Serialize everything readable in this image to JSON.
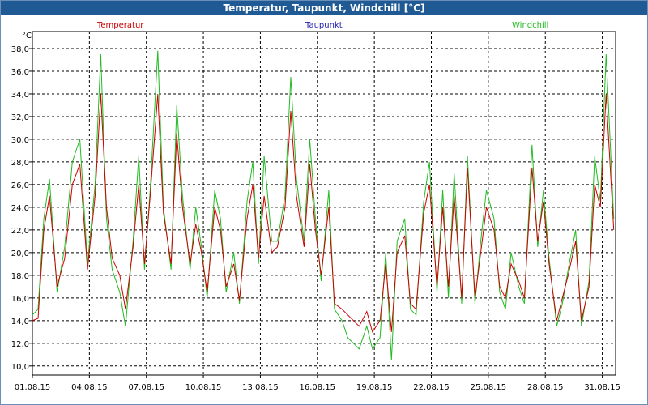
{
  "window": {
    "title": "Temperatur, Taupunkt, Windchill [°C]"
  },
  "colors": {
    "temperatur": "#cc0000",
    "taupunkt": "#2020b0",
    "windchill": "#22bb22",
    "grid": "#000000",
    "title_bg": "#1f5a94"
  },
  "chart_data": {
    "type": "line",
    "title": "Temperatur, Taupunkt, Windchill [°C]",
    "ylabel": "°C",
    "xlabel": "",
    "ylim": [
      9.2,
      39.5
    ],
    "xlim": [
      0,
      30.7
    ],
    "grid": true,
    "legend_position": "top",
    "yticks": [
      "10,0",
      "12,0",
      "14,0",
      "16,0",
      "18,0",
      "20,0",
      "22,0",
      "24,0",
      "26,0",
      "28,0",
      "30,0",
      "32,0",
      "34,0",
      "36,0",
      "38,0"
    ],
    "ytick_values": [
      10,
      12,
      14,
      16,
      18,
      20,
      22,
      24,
      26,
      28,
      30,
      32,
      34,
      36,
      38
    ],
    "xticks": [
      "01.08.15",
      "04.08.15",
      "07.08.15",
      "10.08.15",
      "13.08.15",
      "16.08.15",
      "19.08.15",
      "22.08.15",
      "25.08.15",
      "28.08.15",
      "31.08.15"
    ],
    "xtick_values": [
      0,
      3,
      6,
      9,
      12,
      15,
      18,
      21,
      24,
      27,
      30
    ],
    "series": [
      {
        "name": "Temperatur",
        "x": [
          0,
          0.3,
          0.6,
          0.9,
          1.3,
          1.7,
          2.1,
          2.5,
          2.9,
          3.3,
          3.6,
          3.9,
          4.2,
          4.6,
          4.9,
          5.3,
          5.6,
          5.9,
          6.2,
          6.6,
          6.9,
          7.3,
          7.6,
          7.9,
          8.3,
          8.6,
          8.9,
          9.2,
          9.6,
          9.9,
          10.2,
          10.6,
          10.9,
          11.3,
          11.6,
          11.9,
          12.2,
          12.6,
          12.9,
          13.3,
          13.6,
          13.9,
          14.3,
          14.6,
          14.9,
          15.2,
          15.6,
          15.9,
          16.3,
          16.6,
          16.9,
          17.2,
          17.6,
          17.9,
          18.3,
          18.6,
          18.9,
          19.2,
          19.6,
          19.9,
          20.2,
          20.6,
          20.9,
          21.3,
          21.6,
          21.9,
          22.2,
          22.6,
          22.9,
          23.3,
          23.6,
          23.9,
          24.3,
          24.6,
          24.9,
          25.2,
          25.6,
          25.9,
          26.3,
          26.6,
          26.9,
          27.2,
          27.6,
          27.9,
          28.2,
          28.6,
          28.9,
          29.3,
          29.6,
          29.9,
          30.2,
          30.6
        ],
        "y": [
          14.0,
          14.2,
          22.0,
          25.0,
          17.0,
          19.5,
          26.0,
          27.8,
          18.5,
          25.0,
          34.0,
          24.0,
          19.5,
          18.0,
          15.0,
          20.5,
          26.0,
          19.0,
          25.0,
          34.0,
          23.5,
          19.0,
          30.5,
          24.0,
          19.0,
          22.5,
          20.0,
          16.5,
          24.0,
          22.0,
          17.0,
          19.0,
          15.8,
          23.0,
          26.0,
          19.5,
          25.0,
          20.0,
          20.5,
          24.0,
          32.5,
          25.0,
          20.5,
          27.8,
          22.0,
          18.0,
          24.0,
          15.5,
          15.0,
          14.5,
          14.0,
          13.5,
          14.8,
          13.0,
          14.0,
          19.0,
          13.0,
          20.0,
          21.5,
          15.5,
          15.0,
          23.5,
          26.0,
          17.0,
          24.0,
          17.0,
          25.0,
          16.0,
          27.5,
          16.0,
          20.0,
          24.0,
          22.0,
          17.0,
          16.0,
          19.0,
          17.5,
          16.0,
          27.5,
          21.0,
          24.5,
          19.0,
          14.0,
          16.0,
          18.0,
          21.0,
          14.0,
          17.0,
          26.0,
          24.0,
          34.0,
          22.0
        ]
      },
      {
        "name": "Taupunkt",
        "x": [],
        "y": []
      },
      {
        "name": "Windchill",
        "x": [
          0,
          0.3,
          0.6,
          0.9,
          1.3,
          1.7,
          2.1,
          2.5,
          2.9,
          3.3,
          3.6,
          3.9,
          4.2,
          4.6,
          4.9,
          5.3,
          5.6,
          5.9,
          6.2,
          6.6,
          6.9,
          7.3,
          7.6,
          7.9,
          8.3,
          8.6,
          8.9,
          9.2,
          9.6,
          9.9,
          10.2,
          10.6,
          10.9,
          11.3,
          11.6,
          11.9,
          12.2,
          12.6,
          12.9,
          13.3,
          13.6,
          13.9,
          14.3,
          14.6,
          14.9,
          15.2,
          15.6,
          15.9,
          16.3,
          16.6,
          16.9,
          17.2,
          17.6,
          17.9,
          18.3,
          18.6,
          18.9,
          19.2,
          19.6,
          19.9,
          20.2,
          20.6,
          20.9,
          21.3,
          21.6,
          21.9,
          22.2,
          22.6,
          22.9,
          23.3,
          23.6,
          23.9,
          24.3,
          24.6,
          24.9,
          25.2,
          25.6,
          25.9,
          26.3,
          26.6,
          26.9,
          27.2,
          27.6,
          27.9,
          28.2,
          28.6,
          28.9,
          29.3,
          29.6,
          29.9,
          30.2,
          30.6
        ],
        "y": [
          14.5,
          15.0,
          23.0,
          26.5,
          16.5,
          20.5,
          28.0,
          30.0,
          19.0,
          26.0,
          37.5,
          23.0,
          18.5,
          16.5,
          13.5,
          21.0,
          28.5,
          18.5,
          25.5,
          37.8,
          24.0,
          18.5,
          33.0,
          25.0,
          18.5,
          24.0,
          20.5,
          16.0,
          25.5,
          23.0,
          16.5,
          20.0,
          15.5,
          24.5,
          28.0,
          19.0,
          28.5,
          21.0,
          21.0,
          25.0,
          35.5,
          26.5,
          21.0,
          30.0,
          23.0,
          17.5,
          25.5,
          15.0,
          14.0,
          12.5,
          12.0,
          11.5,
          13.5,
          11.5,
          12.5,
          20.0,
          10.5,
          21.0,
          23.0,
          15.0,
          14.5,
          24.5,
          28.0,
          16.5,
          25.5,
          16.0,
          27.0,
          15.5,
          28.5,
          15.5,
          21.0,
          25.5,
          23.0,
          16.5,
          15.0,
          20.0,
          17.0,
          15.5,
          29.5,
          20.5,
          25.5,
          19.5,
          13.5,
          15.5,
          18.5,
          22.0,
          13.5,
          17.5,
          28.5,
          24.5,
          37.5,
          23.0
        ]
      }
    ]
  }
}
